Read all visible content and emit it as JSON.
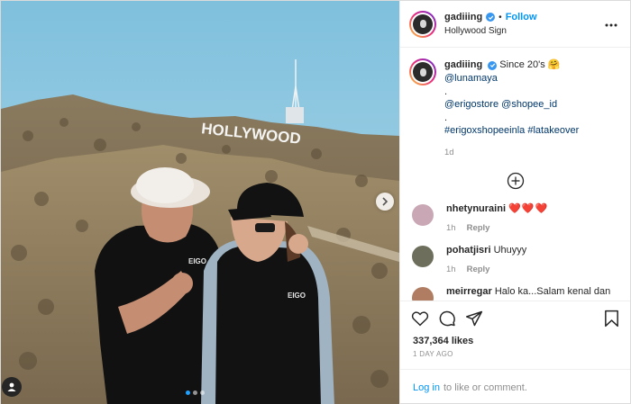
{
  "photo": {
    "sign_text": "HOLLYWOOD",
    "shirt_print": "EIGO",
    "carousel_dots": 3,
    "active_dot": 0
  },
  "header": {
    "username": "gadiiing",
    "separator": "•",
    "follow_label": "Follow",
    "location": "Hollywood Sign"
  },
  "caption": {
    "username": "gadiiing",
    "text_part1": "Since 20's",
    "emoji": "🤗",
    "mention1": "@lunamaya",
    "dot1": ".",
    "mention2": "@erigostore",
    "mention3": "@shopee_id",
    "dot2": ".",
    "hashtag1": "#erigoxshopeeinla",
    "hashtag2": "#latakeover",
    "age": "1d"
  },
  "comments": [
    {
      "username": "nhetynuraini",
      "text": "❤️❤️❤️",
      "time": "1h",
      "reply_label": "Reply",
      "avatar_color": "#c9a7b4"
    },
    {
      "username": "pohatjisri",
      "text": "Uhuyyy",
      "time": "1h",
      "reply_label": "Reply",
      "avatar_color": "#6d6f5c"
    },
    {
      "username": "meirregar",
      "text": "Halo ka...Salam kenal dan",
      "time": "",
      "reply_label": "",
      "avatar_color": "#b07d62"
    }
  ],
  "likes": "337,364 likes",
  "date": "1 DAY AGO",
  "login": {
    "link_label": "Log in",
    "rest": "to like or comment."
  },
  "colors": {
    "accent_blue": "#0095f6",
    "verified_blue": "#3897f0",
    "link_dark": "#00376b"
  }
}
